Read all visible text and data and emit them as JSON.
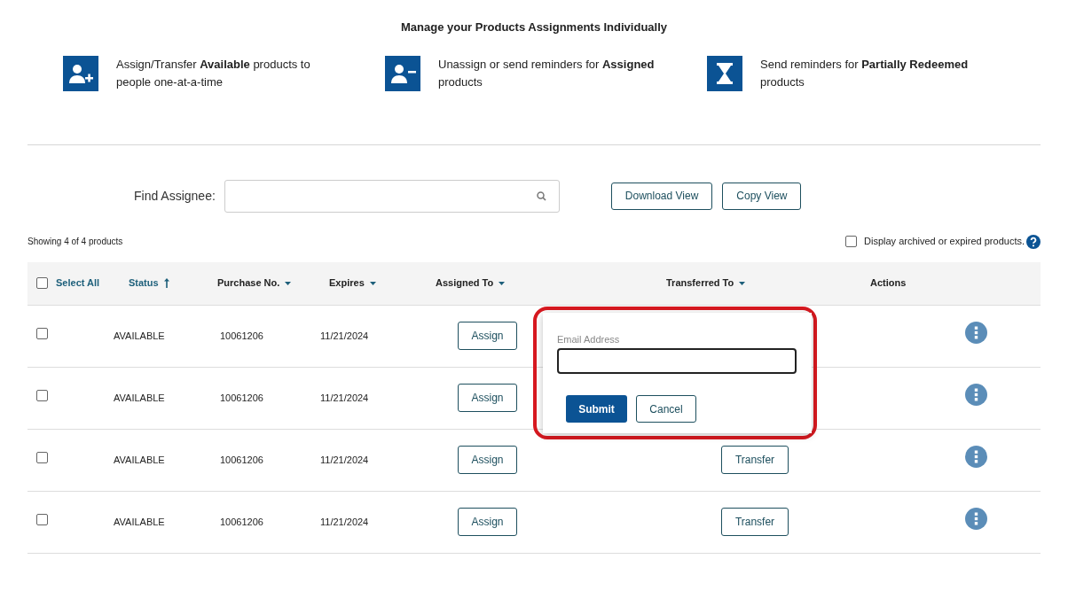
{
  "heading": "Manage your Products Assignments Individually",
  "features": [
    {
      "kind": "user-plus",
      "text": "Assign/Transfer **Available** products to people one-at-a-time"
    },
    {
      "kind": "user-minus",
      "text": "Unassign or send reminders for **Assigned** products"
    },
    {
      "kind": "hourglass",
      "text": "Send reminders for **Partially Redeemed** products"
    }
  ],
  "search": {
    "label": "Find Assignee:"
  },
  "toolbar_buttons": [
    "Download View",
    "Copy View"
  ],
  "summary": "Showing 4 of 4 products",
  "archived_toggle": {
    "label": "Display archived or expired products.",
    "checked": false
  },
  "table": {
    "select_all": {
      "label": "Select All",
      "checked": false
    },
    "columns": [
      {
        "label": "Status",
        "kind": "sorted"
      },
      {
        "label": "Purchase No.",
        "kind": "dropdown"
      },
      {
        "label": "Expires",
        "kind": "dropdown"
      },
      {
        "label": "Assigned To",
        "kind": "dropdown"
      },
      {
        "label": "Transferred To",
        "kind": "dropdown"
      },
      {
        "label": "Actions",
        "kind": "plain"
      }
    ],
    "rows": [
      {
        "checked": false,
        "status": "AVAILABLE",
        "purchase_no": "10061206",
        "expires": "11/21/2024",
        "assign": "Assign"
      },
      {
        "checked": false,
        "status": "AVAILABLE",
        "purchase_no": "10061206",
        "expires": "11/21/2024",
        "assign": "Assign"
      },
      {
        "checked": false,
        "status": "AVAILABLE",
        "purchase_no": "10061206",
        "expires": "11/21/2024",
        "assign": "Assign",
        "transfer": "Transfer"
      },
      {
        "checked": false,
        "status": "AVAILABLE",
        "purchase_no": "10061206",
        "expires": "11/21/2024",
        "assign": "Assign",
        "transfer": "Transfer"
      }
    ]
  },
  "popup": {
    "label": "Email Address",
    "submit": "Submit",
    "cancel": "Cancel",
    "highlighted": true
  }
}
